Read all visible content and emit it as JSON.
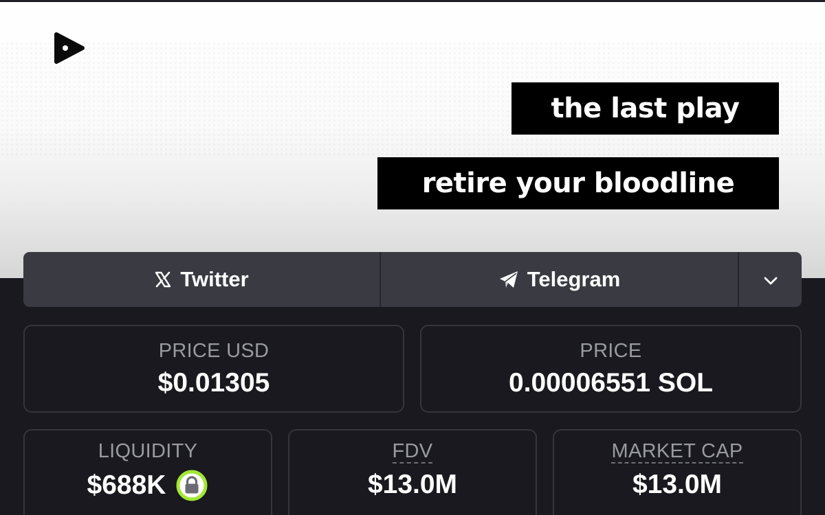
{
  "banner": {
    "tagline_1": "the last play",
    "tagline_2": "retire your bloodline",
    "logo_icon": "play-logo-icon"
  },
  "social": {
    "twitter_label": "Twitter",
    "twitter_icon": "x-icon",
    "telegram_label": "Telegram",
    "telegram_icon": "paper-plane-icon",
    "more_icon": "chevron-down-icon"
  },
  "stats": {
    "price_usd": {
      "label": "PRICE USD",
      "value": "$0.01305"
    },
    "price": {
      "label": "PRICE",
      "value": "0.00006551 SOL"
    },
    "liquidity": {
      "label": "LIQUIDITY",
      "value": "$688K",
      "badge_icon": "lock-icon"
    },
    "fdv": {
      "label": "FDV",
      "value": "$13.0M"
    },
    "market_cap": {
      "label": "MARKET CAP",
      "value": "$13.0M"
    }
  },
  "colors": {
    "background": "#19191f",
    "social_bar": "#3a3a43",
    "card_border": "#35353d",
    "label": "#9a9aa2",
    "value": "#ffffff",
    "lock_ring": "#a3e635"
  }
}
